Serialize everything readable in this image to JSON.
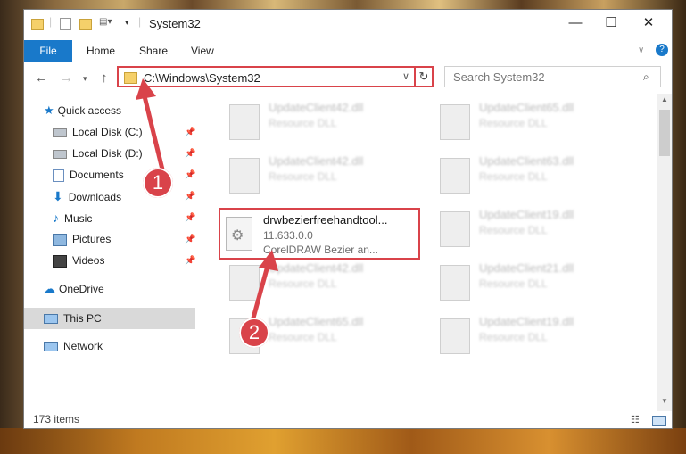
{
  "window": {
    "title": "System32"
  },
  "ribbon": {
    "file": "File",
    "home": "Home",
    "share": "Share",
    "view": "View"
  },
  "address": {
    "path": "C:\\Windows\\System32"
  },
  "search": {
    "placeholder": "Search System32"
  },
  "nav": {
    "quick_access": "Quick access",
    "local_c": "Local Disk (C:)",
    "local_d": "Local Disk (D:)",
    "documents": "Documents",
    "downloads": "Downloads",
    "music": "Music",
    "pictures": "Pictures",
    "videos": "Videos",
    "onedrive": "OneDrive",
    "this_pc": "This PC",
    "network": "Network"
  },
  "files": [
    {
      "name": "UpdateClient42.dll",
      "desc": "Resource DLL"
    },
    {
      "name": "UpdateClient65.dll",
      "desc": "Resource DLL"
    },
    {
      "name": "UpdateClient42.dll",
      "desc": "Resource DLL"
    },
    {
      "name": "UpdateClient63.dll",
      "desc": "Resource DLL"
    },
    {
      "name": "UpdateClient19.dll",
      "desc": "Resource DLL"
    },
    {
      "name": "UpdateClient42.dll",
      "desc": "Resource DLL"
    },
    {
      "name": "UpdateClient21.dll",
      "desc": "Resource DLL"
    },
    {
      "name": "UpdateClient65.dll",
      "desc": "Resource DLL"
    },
    {
      "name": "UpdateClient19.dll",
      "desc": "Resource DLL"
    }
  ],
  "selected_file": {
    "name": "drwbezierfreehandtool...",
    "version": "11.633.0.0",
    "description": "CorelDRAW Bezier an..."
  },
  "status": {
    "items": "173 items"
  },
  "annotations": {
    "step1": "1",
    "step2": "2"
  },
  "colors": {
    "accent": "#1979ca",
    "highlight": "#d9434a"
  }
}
